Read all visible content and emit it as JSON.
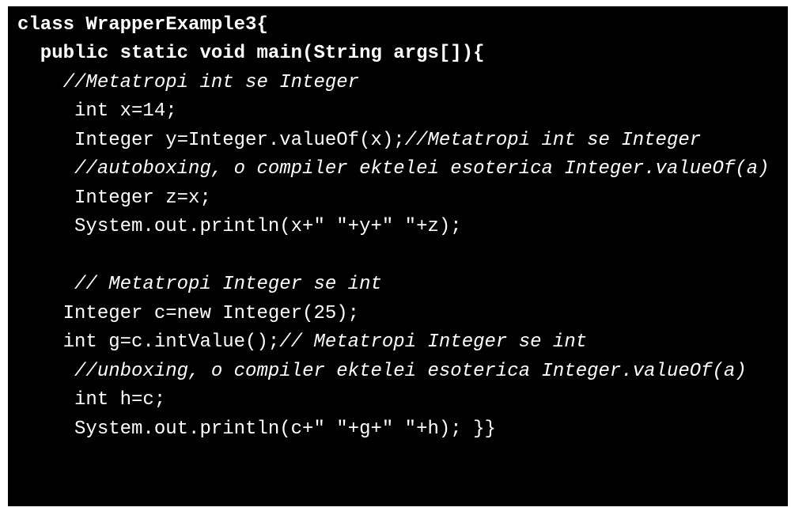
{
  "code": {
    "l1": "class WrapperExample3{",
    "l2": "  public static void main(String args[]){",
    "l3a": "    ",
    "l3b": "//Metatropi int se Integer",
    "l4": "     int x=14;",
    "l5a": "     Integer y=Integer.valueOf(x);",
    "l5b": "//Metatropi int se Integer",
    "l6a": "     ",
    "l6b": "//autoboxing, o compiler ektelei esoterica Integer.valueOf(a)",
    "l7": "     Integer z=x;",
    "l8": "     System.out.println(x+\" \"+y+\" \"+z);",
    "l9": " ",
    "l10a": "     ",
    "l10b": "// Metatropi Integer se int",
    "l11": "    Integer c=new Integer(25);",
    "l12a": "    int g=c.intValue();",
    "l12b": "// Metatropi Integer se int",
    "l13a": "     ",
    "l13b": "//unboxing, o compiler ektelei esoterica Integer.valueOf(a)",
    "l14": "     int h=c;",
    "l15": "     System.out.println(c+\" \"+g+\" \"+h);",
    "l15end": " }}"
  }
}
